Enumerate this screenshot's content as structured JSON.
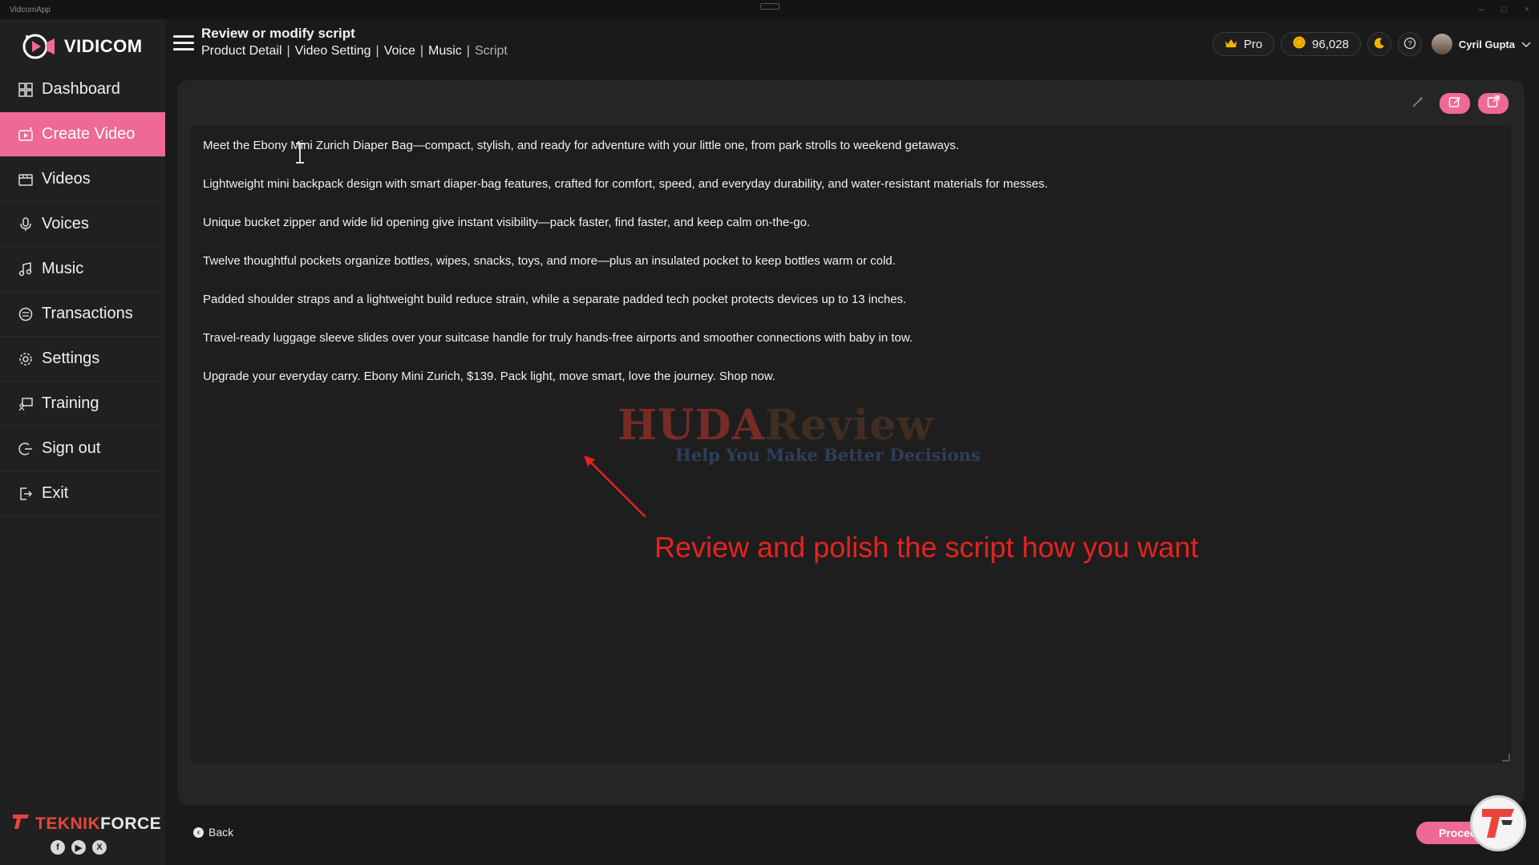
{
  "window": {
    "title": "VidcomApp"
  },
  "app": {
    "name": "VIDICOM"
  },
  "sidebar": {
    "items": [
      {
        "label": "Dashboard",
        "icon": "grid-icon"
      },
      {
        "label": "Create Video",
        "icon": "create-video-icon",
        "active": true
      },
      {
        "label": "Videos",
        "icon": "film-icon"
      },
      {
        "label": "Voices",
        "icon": "microphone-icon"
      },
      {
        "label": "Music",
        "icon": "music-note-icon"
      },
      {
        "label": "Transactions",
        "icon": "transactions-icon"
      },
      {
        "label": "Settings",
        "icon": "gear-icon"
      },
      {
        "label": "Training",
        "icon": "training-icon"
      },
      {
        "label": "Sign out",
        "icon": "sign-out-icon"
      },
      {
        "label": "Exit",
        "icon": "exit-icon"
      }
    ],
    "footer": {
      "brand_part1": "TEKNIK",
      "brand_part2": "FORCE",
      "socials": [
        "f",
        "▶",
        "X"
      ]
    }
  },
  "header": {
    "title": "Review or modify script",
    "breadcrumbs": [
      "Product Detail",
      "Video Setting",
      "Voice",
      "Music",
      "Script"
    ],
    "plan": "Pro",
    "credits": "96,028",
    "user_name": "Cyril Gupta"
  },
  "script": {
    "paragraphs": [
      "Meet the Ebony Mini Zurich Diaper Bag—compact, stylish, and ready for adventure with your little one, from park strolls to weekend getaways.",
      "Lightweight mini backpack design with smart diaper-bag features, crafted for comfort, speed, and everyday durability, and water-resistant materials for messes.",
      "Unique bucket zipper and wide lid opening give instant visibility—pack faster, find faster, and keep calm on-the-go.",
      "Twelve thoughtful pockets organize bottles, wipes, snacks, toys, and more—plus an insulated pocket to keep bottles warm or cold.",
      "Padded shoulder straps and a lightweight build reduce strain, while a separate padded tech pocket protects devices up to 13 inches.",
      "Travel-ready luggage sleeve slides over your suitcase handle for truly hands-free airports and smoother connections with baby in tow.",
      "Upgrade your everyday carry. Ebony Mini Zurich, $139. Pack light, move smart, love the journey. Shop now."
    ]
  },
  "overlay": {
    "watermark_title_part1": "HUDA",
    "watermark_title_part2": "Review",
    "watermark_subtitle": "Help You Make Better Decisions",
    "annotation": "Review and polish the script how you want"
  },
  "footer": {
    "back_label": "Back",
    "proceed_label": "Proceed"
  },
  "colors": {
    "accent": "#ee6a95",
    "annotation": "#e5231f"
  }
}
